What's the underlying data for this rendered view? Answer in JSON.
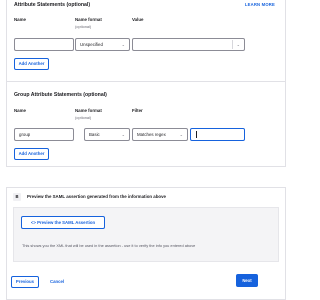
{
  "attr": {
    "title": "Attribute Statements (optional)",
    "learn_more": "LEARN MORE",
    "col_name": "Name",
    "col_format": "Name format",
    "col_format_sub": "(optional)",
    "col_value": "Value",
    "row": {
      "name": "",
      "format": "Unspecified",
      "value": ""
    },
    "add_another": "Add Another"
  },
  "group": {
    "title": "Group Attribute Statements (optional)",
    "col_name": "Name",
    "col_format": "Name format",
    "col_format_sub": "(optional)",
    "col_filter": "Filter",
    "row": {
      "name": "group",
      "format": "Basic",
      "filter_type": "Matches regex",
      "filter_value": ""
    },
    "add_another": "Add Another"
  },
  "preview": {
    "badge": "B",
    "heading": "Preview the SAML assertion generated from the information above",
    "button": "<> Preview the SAML Assertion",
    "hint": "This shows you the XML that will be used in the assertion - use it to verify the info you entered above"
  },
  "footer": {
    "previous": "Previous",
    "cancel": "Cancel",
    "next": "Next"
  },
  "icons": {
    "select": "chevron-down-icon"
  },
  "colors": {
    "accent": "#1662dd",
    "border": "#8c8c96"
  }
}
